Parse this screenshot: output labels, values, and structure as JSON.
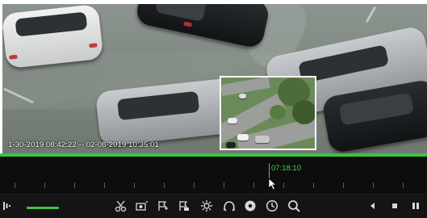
{
  "window": {
    "type": "nvr-playback"
  },
  "video": {
    "timestamp_range": "1-30-2019 08:42:22 -- 02-08-2019 10:35:01"
  },
  "timeline": {
    "cursor_time": "07:18:10",
    "accent_color": "#3ec23e"
  },
  "toolbar": {
    "left_icon": "menu-bars-icon",
    "volume_level": 1.0,
    "buttons": [
      {
        "name": "clip-icon"
      },
      {
        "name": "snapshot-icon"
      },
      {
        "name": "tag-icon"
      },
      {
        "name": "custom-tag-icon"
      },
      {
        "name": "settings-icon"
      },
      {
        "name": "digital-zoom-icon"
      },
      {
        "name": "record-icon"
      },
      {
        "name": "clock-icon"
      },
      {
        "name": "search-icon"
      }
    ],
    "playback_buttons": [
      {
        "name": "rewind-icon"
      },
      {
        "name": "stop-icon"
      },
      {
        "name": "pause-icon"
      }
    ]
  }
}
